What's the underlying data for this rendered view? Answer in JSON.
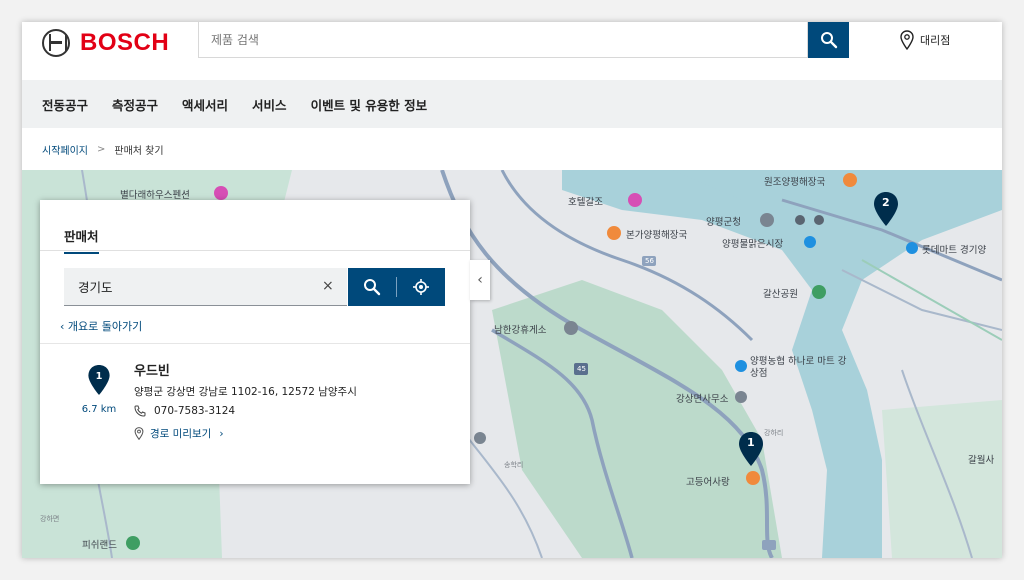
{
  "header": {
    "brand": "BOSCH",
    "search_placeholder": "제품 검색",
    "dealer_label": "대리점"
  },
  "nav": {
    "items": [
      "전동공구",
      "측정공구",
      "액세서리",
      "서비스",
      "이벤트 및 유용한 정보"
    ]
  },
  "breadcrumb": {
    "home": "시작페이지",
    "separator": ">",
    "current": "판매처 찾기"
  },
  "panel": {
    "tab_label": "판매처",
    "location_value": "경기도",
    "clear_symbol": "×",
    "back_link": "‹ 개요로 돌아가기",
    "collapse_symbol": "‹"
  },
  "result": {
    "pin_number": "1",
    "distance": "6.7 km",
    "name": "우드빈",
    "address": "양평군 강상면 강남로 1102-16, 12572 남양주시",
    "phone": "070-7583-3124",
    "route_label": "경로 미리보기",
    "route_arrow": "›"
  },
  "map": {
    "labels": [
      "별다래하우스펜션",
      "호텔갈조",
      "본가양평해장국",
      "원조양평해장국",
      "양평군청",
      "양평물맑은시장",
      "롯데마트 경기양",
      "갈산공원",
      "남한강휴게소",
      "양평농협 하나로 마트 강상점",
      "강상면사무소",
      "고등어사랑",
      "갈월사",
      "피쉬랜드",
      "강하면",
      "45",
      "56",
      "송학리",
      "강하리"
    ],
    "pins": [
      "2",
      "1"
    ]
  },
  "colors": {
    "brand_red": "#e20015",
    "primary_blue": "#00497b",
    "water": "#a8d1da",
    "green_area": "#b7d8c8"
  }
}
